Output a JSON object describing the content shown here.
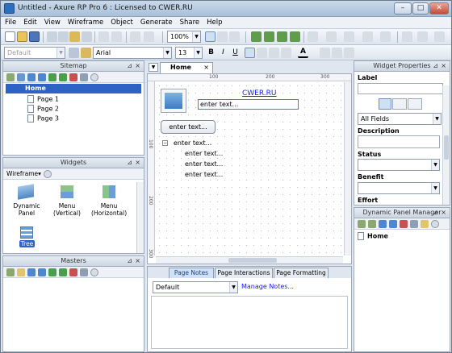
{
  "window": {
    "title": "Untitled - Axure RP Pro 6 : Licensed to CWER.RU",
    "controls": [
      "–",
      "□",
      "✕"
    ]
  },
  "menu": [
    "File",
    "Edit",
    "View",
    "Wireframe",
    "Object",
    "Generate",
    "Share",
    "Help"
  ],
  "toolbar1": {
    "zoom": "100%"
  },
  "toolbar2": {
    "style": "Default",
    "font": "Arial",
    "size": "13",
    "bold": "B",
    "italic": "I",
    "underline": "U",
    "text_color": "A"
  },
  "sitemap": {
    "title": "Sitemap",
    "items": [
      {
        "label": "Home",
        "selected": true
      },
      {
        "label": "Page 1"
      },
      {
        "label": "Page 2"
      },
      {
        "label": "Page 3"
      }
    ]
  },
  "widgets": {
    "title": "Widgets",
    "library": "Wireframe",
    "items": [
      {
        "label": "Dynamic Panel"
      },
      {
        "label": "Menu\n(Vertical)"
      },
      {
        "label": "Menu\n(Horizontal)"
      },
      {
        "label": "Tree"
      }
    ]
  },
  "masters": {
    "title": "Masters"
  },
  "canvas": {
    "tab": "Home",
    "ruler_h": [
      "100",
      "200",
      "300"
    ],
    "ruler_v": [
      "100",
      "200",
      "300"
    ],
    "link_text": "CWER.RU",
    "textfield_text": "enter text...",
    "button_text": "enter text...",
    "tree_root": "enter text...",
    "tree_children": [
      "enter text...",
      "enter text...",
      "enter text..."
    ]
  },
  "bottom": {
    "tabs": [
      "Page Notes",
      "Page Interactions",
      "Page Formatting"
    ],
    "notes_select": "Default",
    "manage_notes": "Manage Notes..."
  },
  "widget_properties": {
    "title": "Widget Properties",
    "label": "Label",
    "fields_select": "All Fields",
    "description": "Description",
    "status": "Status",
    "benefit": "Benefit",
    "effort": "Effort"
  },
  "dpm": {
    "title": "Dynamic Panel Manager",
    "item": "Home"
  },
  "colors": {
    "accent": "#2f62c5",
    "link": "#1a1aff",
    "panel_header": "#ccd6e2"
  }
}
